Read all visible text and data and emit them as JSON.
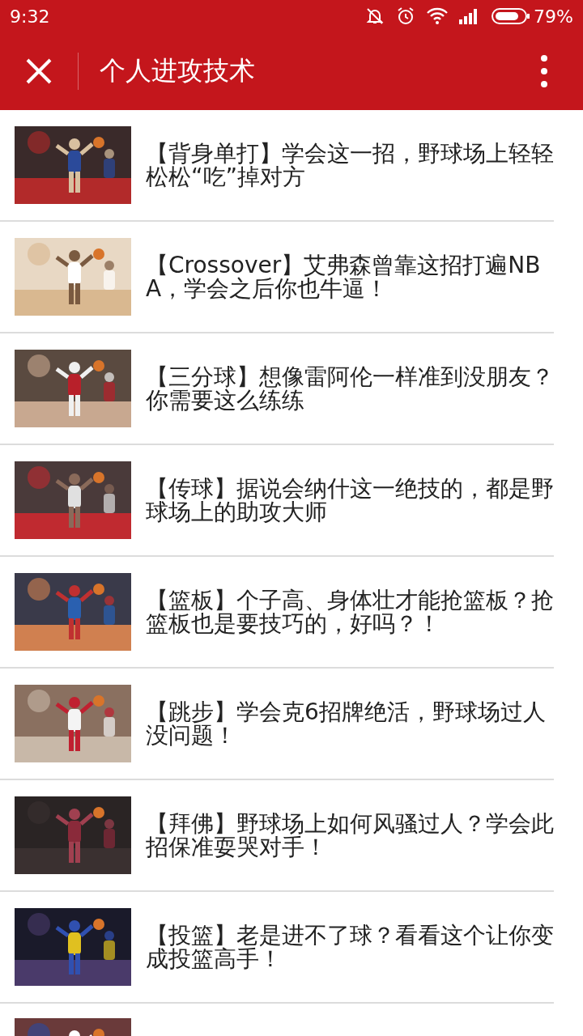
{
  "status_bar": {
    "time": "9:32",
    "battery_text": "79%"
  },
  "header": {
    "title": "个人进攻技术"
  },
  "articles": [
    {
      "title": "【背身单打】学会这一招，野球场上轻轻松松“吃”掉对方"
    },
    {
      "title": "【Crossover】艾弗森曾靠这招打遍NBA，学会之后你也牛逼！"
    },
    {
      "title": "【三分球】想像雷阿伦一样准到没朋友？你需要这么练练"
    },
    {
      "title": "【传球】据说会纳什这一绝技的，都是野球场上的助攻大师"
    },
    {
      "title": "【篮板】个子高、身体壮才能抢篮板？抢篮板也是要技巧的，好吗？！"
    },
    {
      "title": "【跳步】学会克6招牌绝活，野球场过人没问题！"
    },
    {
      "title": "【拜佛】野球场上如何风骚过人？学会此招保准耍哭对手！"
    },
    {
      "title": "【投篮】老是进不了球？看看这个让你变成投篮高手！"
    }
  ]
}
